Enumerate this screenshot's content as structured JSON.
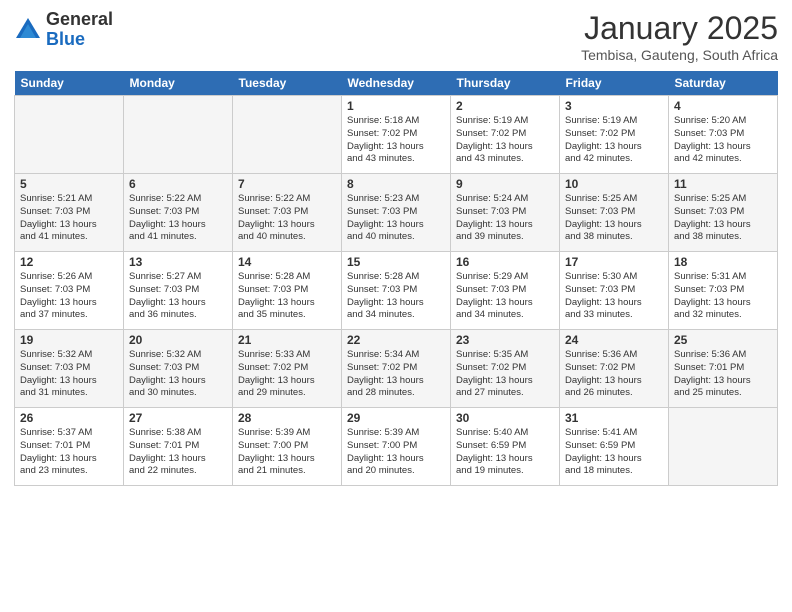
{
  "logo": {
    "general": "General",
    "blue": "Blue"
  },
  "title": "January 2025",
  "location": "Tembisa, Gauteng, South Africa",
  "days_of_week": [
    "Sunday",
    "Monday",
    "Tuesday",
    "Wednesday",
    "Thursday",
    "Friday",
    "Saturday"
  ],
  "weeks": [
    [
      {
        "num": "",
        "info": "",
        "empty": true
      },
      {
        "num": "",
        "info": "",
        "empty": true
      },
      {
        "num": "",
        "info": "",
        "empty": true
      },
      {
        "num": "1",
        "info": "Sunrise: 5:18 AM\nSunset: 7:02 PM\nDaylight: 13 hours\nand 43 minutes."
      },
      {
        "num": "2",
        "info": "Sunrise: 5:19 AM\nSunset: 7:02 PM\nDaylight: 13 hours\nand 43 minutes."
      },
      {
        "num": "3",
        "info": "Sunrise: 5:19 AM\nSunset: 7:02 PM\nDaylight: 13 hours\nand 42 minutes."
      },
      {
        "num": "4",
        "info": "Sunrise: 5:20 AM\nSunset: 7:03 PM\nDaylight: 13 hours\nand 42 minutes."
      }
    ],
    [
      {
        "num": "5",
        "info": "Sunrise: 5:21 AM\nSunset: 7:03 PM\nDaylight: 13 hours\nand 41 minutes."
      },
      {
        "num": "6",
        "info": "Sunrise: 5:22 AM\nSunset: 7:03 PM\nDaylight: 13 hours\nand 41 minutes."
      },
      {
        "num": "7",
        "info": "Sunrise: 5:22 AM\nSunset: 7:03 PM\nDaylight: 13 hours\nand 40 minutes."
      },
      {
        "num": "8",
        "info": "Sunrise: 5:23 AM\nSunset: 7:03 PM\nDaylight: 13 hours\nand 40 minutes."
      },
      {
        "num": "9",
        "info": "Sunrise: 5:24 AM\nSunset: 7:03 PM\nDaylight: 13 hours\nand 39 minutes."
      },
      {
        "num": "10",
        "info": "Sunrise: 5:25 AM\nSunset: 7:03 PM\nDaylight: 13 hours\nand 38 minutes."
      },
      {
        "num": "11",
        "info": "Sunrise: 5:25 AM\nSunset: 7:03 PM\nDaylight: 13 hours\nand 38 minutes."
      }
    ],
    [
      {
        "num": "12",
        "info": "Sunrise: 5:26 AM\nSunset: 7:03 PM\nDaylight: 13 hours\nand 37 minutes."
      },
      {
        "num": "13",
        "info": "Sunrise: 5:27 AM\nSunset: 7:03 PM\nDaylight: 13 hours\nand 36 minutes."
      },
      {
        "num": "14",
        "info": "Sunrise: 5:28 AM\nSunset: 7:03 PM\nDaylight: 13 hours\nand 35 minutes."
      },
      {
        "num": "15",
        "info": "Sunrise: 5:28 AM\nSunset: 7:03 PM\nDaylight: 13 hours\nand 34 minutes."
      },
      {
        "num": "16",
        "info": "Sunrise: 5:29 AM\nSunset: 7:03 PM\nDaylight: 13 hours\nand 34 minutes."
      },
      {
        "num": "17",
        "info": "Sunrise: 5:30 AM\nSunset: 7:03 PM\nDaylight: 13 hours\nand 33 minutes."
      },
      {
        "num": "18",
        "info": "Sunrise: 5:31 AM\nSunset: 7:03 PM\nDaylight: 13 hours\nand 32 minutes."
      }
    ],
    [
      {
        "num": "19",
        "info": "Sunrise: 5:32 AM\nSunset: 7:03 PM\nDaylight: 13 hours\nand 31 minutes."
      },
      {
        "num": "20",
        "info": "Sunrise: 5:32 AM\nSunset: 7:03 PM\nDaylight: 13 hours\nand 30 minutes."
      },
      {
        "num": "21",
        "info": "Sunrise: 5:33 AM\nSunset: 7:02 PM\nDaylight: 13 hours\nand 29 minutes."
      },
      {
        "num": "22",
        "info": "Sunrise: 5:34 AM\nSunset: 7:02 PM\nDaylight: 13 hours\nand 28 minutes."
      },
      {
        "num": "23",
        "info": "Sunrise: 5:35 AM\nSunset: 7:02 PM\nDaylight: 13 hours\nand 27 minutes."
      },
      {
        "num": "24",
        "info": "Sunrise: 5:36 AM\nSunset: 7:02 PM\nDaylight: 13 hours\nand 26 minutes."
      },
      {
        "num": "25",
        "info": "Sunrise: 5:36 AM\nSunset: 7:01 PM\nDaylight: 13 hours\nand 25 minutes."
      }
    ],
    [
      {
        "num": "26",
        "info": "Sunrise: 5:37 AM\nSunset: 7:01 PM\nDaylight: 13 hours\nand 23 minutes."
      },
      {
        "num": "27",
        "info": "Sunrise: 5:38 AM\nSunset: 7:01 PM\nDaylight: 13 hours\nand 22 minutes."
      },
      {
        "num": "28",
        "info": "Sunrise: 5:39 AM\nSunset: 7:00 PM\nDaylight: 13 hours\nand 21 minutes."
      },
      {
        "num": "29",
        "info": "Sunrise: 5:39 AM\nSunset: 7:00 PM\nDaylight: 13 hours\nand 20 minutes."
      },
      {
        "num": "30",
        "info": "Sunrise: 5:40 AM\nSunset: 6:59 PM\nDaylight: 13 hours\nand 19 minutes."
      },
      {
        "num": "31",
        "info": "Sunrise: 5:41 AM\nSunset: 6:59 PM\nDaylight: 13 hours\nand 18 minutes."
      },
      {
        "num": "",
        "info": "",
        "empty": true
      }
    ]
  ]
}
